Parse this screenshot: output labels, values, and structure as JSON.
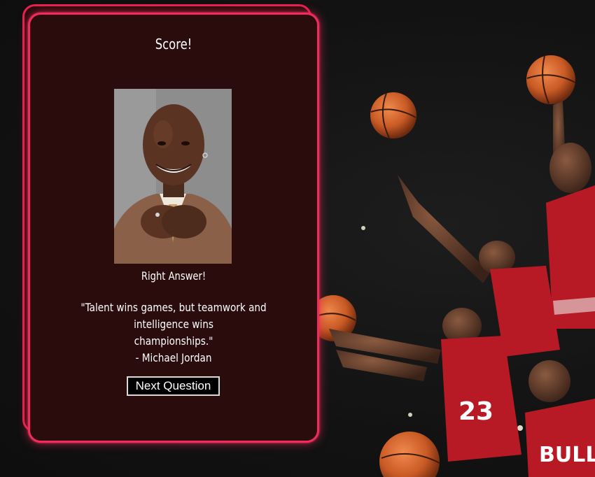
{
  "card": {
    "title": "Score!",
    "result": "Right Answer!",
    "quote_line1": "\"Talent wins games, but teamwork and intelligence wins",
    "quote_line2": "championships.\"",
    "attribution": "- Michael Jordan",
    "next_label": "Next Question"
  },
  "colors": {
    "page_background": "#151515",
    "card_background": "#2a0c0c",
    "card_border": "#ef2c5b",
    "jersey_red": "#b81a25",
    "basketball": "#d0652e"
  }
}
